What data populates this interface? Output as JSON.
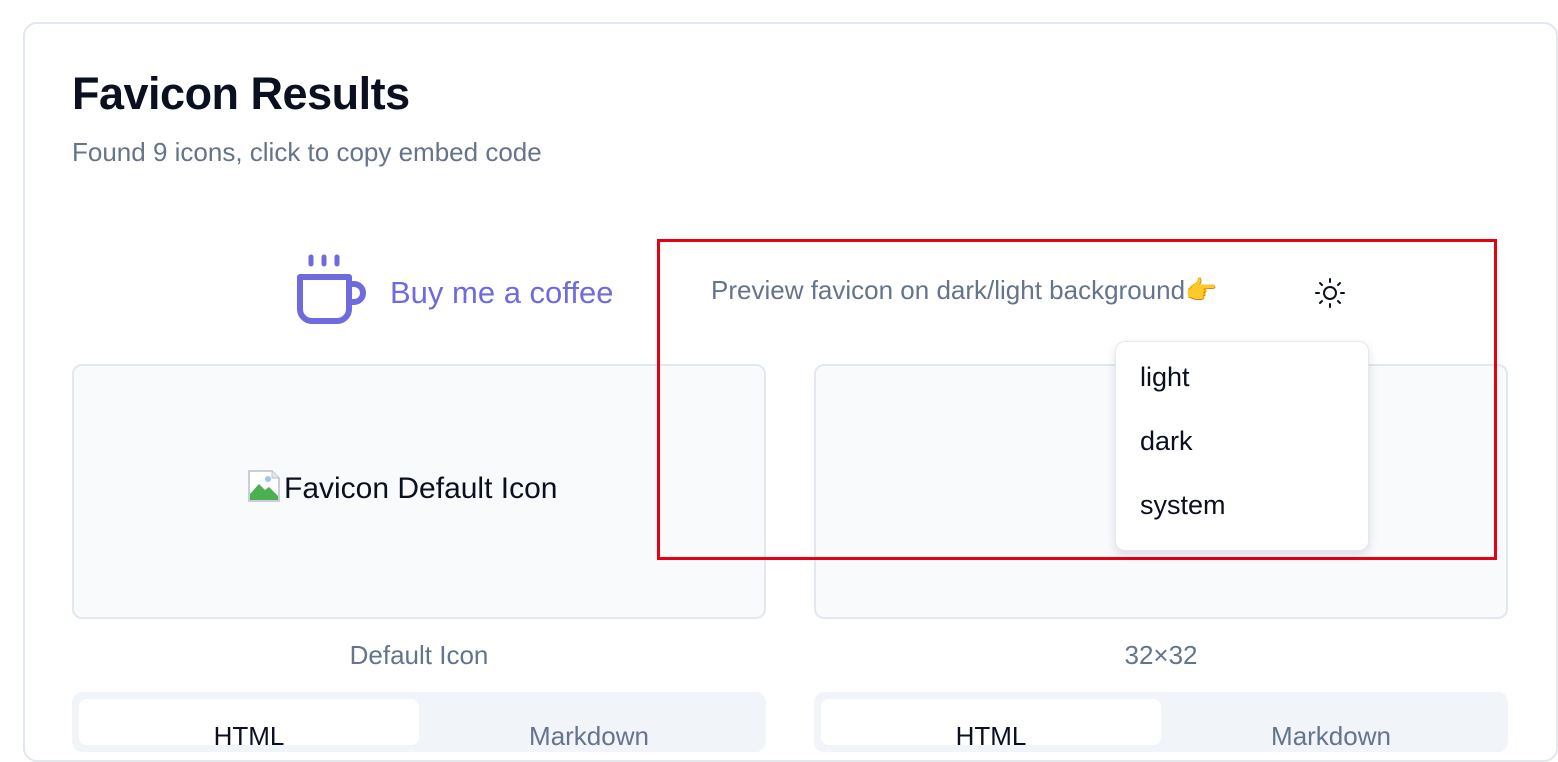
{
  "header": {
    "title": "Favicon Results",
    "subtitle": "Found 9 icons, click to copy embed code"
  },
  "coffee": {
    "label": "Buy me a coffee",
    "icon": "coffee-cup-icon"
  },
  "theme_preview": {
    "label": "Preview favicon on dark/light background👉",
    "icon": "sun-icon",
    "menu_items": [
      "light",
      "dark",
      "system"
    ]
  },
  "icons": [
    {
      "alt_text": "Favicon Default Icon",
      "caption": "Default Icon",
      "tabs": [
        "HTML",
        "Markdown"
      ],
      "active_tab": "HTML"
    },
    {
      "alt_text": "",
      "caption": "32×32",
      "tabs": [
        "HTML",
        "Markdown"
      ],
      "active_tab": "HTML"
    }
  ],
  "colors": {
    "accent": "#6e6bdf",
    "highlight": "#e60012",
    "muted_text": "#64748b",
    "panel_bg": "#f8fafc"
  }
}
